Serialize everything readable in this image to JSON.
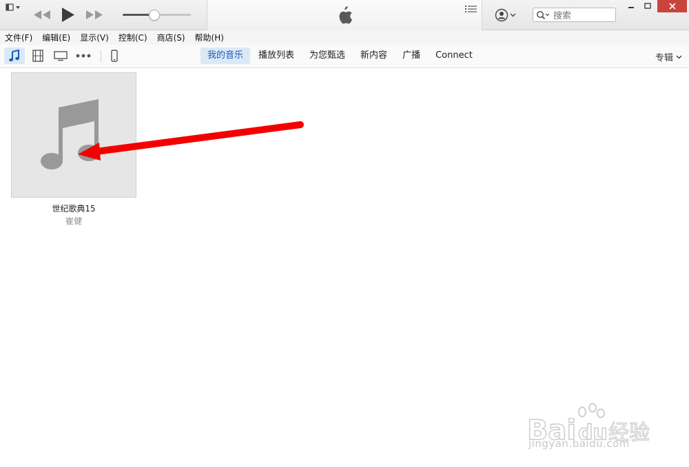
{
  "window": {
    "search_placeholder": "搜索",
    "accent_color": "#1a5eb8",
    "close_color": "#c9443c"
  },
  "menu": {
    "items": [
      "文件(F)",
      "编辑(E)",
      "显示(V)",
      "控制(C)",
      "商店(S)",
      "帮助(H)"
    ]
  },
  "nav": {
    "media_icons": [
      "music-note-icon",
      "film-icon",
      "tv-icon",
      "more-icon",
      "iphone-icon"
    ],
    "tabs": [
      "我的音乐",
      "播放列表",
      "为您甄选",
      "新内容",
      "广播",
      "Connect"
    ],
    "active_tab": "我的音乐",
    "sort_label": "专辑"
  },
  "library": {
    "albums": [
      {
        "title": "世纪歌典15",
        "artist": "崔健"
      }
    ]
  },
  "volume_level": 0.46,
  "watermark": {
    "logo": "Baidu经验",
    "url": "jingyan.baidu.com"
  }
}
